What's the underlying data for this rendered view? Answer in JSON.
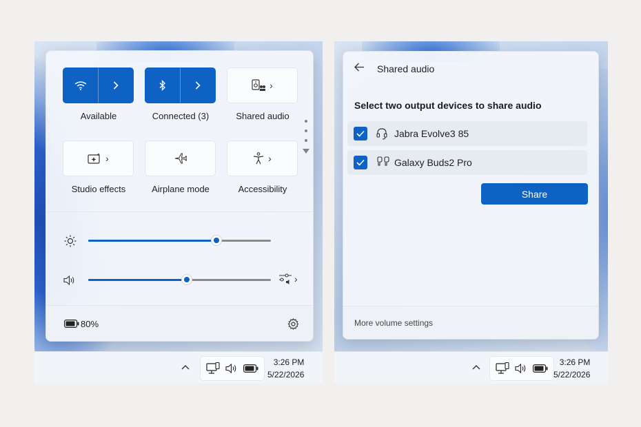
{
  "left": {
    "tiles": [
      {
        "id": "wifi",
        "label": "Available",
        "state": "on",
        "icon": "wifi-icon"
      },
      {
        "id": "bluetooth",
        "label": "Connected (3)",
        "state": "on",
        "icon": "bluetooth-icon"
      },
      {
        "id": "shared-audio",
        "label": "Shared audio",
        "state": "off",
        "icon": "shared-audio-icon"
      },
      {
        "id": "studio-effects",
        "label": "Studio effects",
        "state": "off",
        "icon": "studio-effects-icon"
      },
      {
        "id": "airplane",
        "label": "Airplane mode",
        "state": "off",
        "icon": "airplane-icon"
      },
      {
        "id": "accessibility",
        "label": "Accessibility",
        "state": "off",
        "icon": "accessibility-icon"
      }
    ],
    "brightness": 0.7,
    "volume": 0.54,
    "battery_text": "80%"
  },
  "right": {
    "title": "Shared audio",
    "heading": "Select two output devices to share audio",
    "devices": [
      {
        "name": "Jabra Evolve3 85",
        "checked": true,
        "icon": "headset-icon"
      },
      {
        "name": "Galaxy Buds2 Pro",
        "checked": true,
        "icon": "earbuds-icon"
      }
    ],
    "share_label": "Share",
    "footer_link": "More volume settings"
  },
  "taskbar": {
    "time": "3:26 PM",
    "date": "5/22/2026"
  },
  "colors": {
    "accent": "#0e62c4",
    "page_bg": "#f2efef"
  }
}
